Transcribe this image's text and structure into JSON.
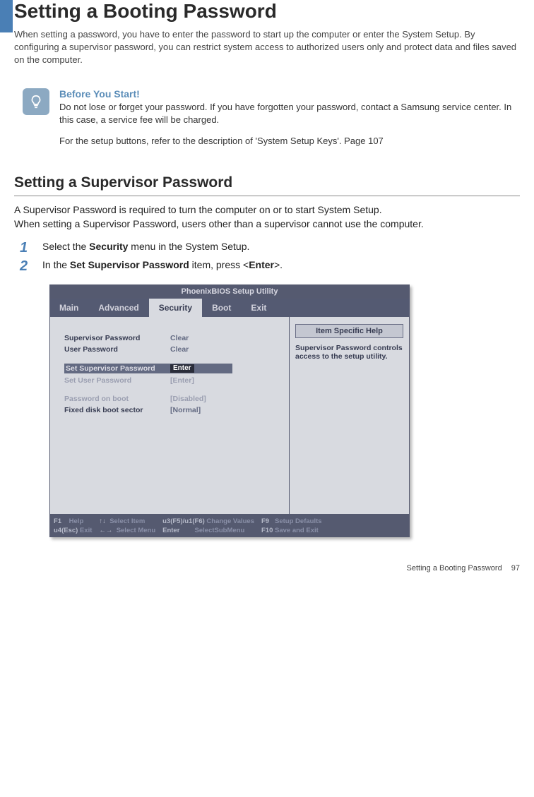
{
  "title": "Setting a Booting Password",
  "intro": "When setting a password, you have to enter the password to start up the computer or enter the System Setup. By configuring a supervisor password, you can restrict system access to authorized users only and protect data and files saved on the computer.",
  "tip": {
    "title": "Before You Start!",
    "text": "Do not lose or forget your password. If you have forgotten your password, contact a Samsung service center. In this case, a service fee will be charged.",
    "sub": "For the setup buttons, refer to the description of 'System Setup Keys'. Page 107"
  },
  "section": {
    "title": "Setting a Supervisor Password",
    "intro": "A Supervisor Password is required to turn the computer on or to start System Setup.\nWhen setting a Supervisor Password, users other than a supervisor cannot use the computer."
  },
  "steps": {
    "s1_pre": "Select the ",
    "s1_bold": "Security",
    "s1_post": " menu in the System Setup.",
    "s2_pre": "In the ",
    "s2_bold": "Set Supervisor Password",
    "s2_mid": " item, press <",
    "s2_bold2": "Enter",
    "s2_post": ">."
  },
  "bios": {
    "title": "PhoenixBIOS Setup Utility",
    "tabs": {
      "main": "Main",
      "advanced": "Advanced",
      "security": "Security",
      "boot": "Boot",
      "exit": "Exit"
    },
    "rows": {
      "sup_label": "Supervisor Password",
      "sup_val": "Clear",
      "user_label": "User Password",
      "user_val": "Clear",
      "setsup_label": "Set Supervisor Password",
      "setsup_val": "Enter",
      "setuser_label": "Set User Password",
      "setuser_val": "[Enter]",
      "pob_label": "Password on boot",
      "pob_val": "[Disabled]",
      "fdbs_label": "Fixed disk boot sector",
      "fdbs_val": "[Normal]"
    },
    "help": {
      "title": "Item Specific Help",
      "text": "Supervisor Password controls access to the setup utility."
    },
    "footer": {
      "f1": "F1",
      "help": "Help",
      "esc": "u4(Esc)",
      "exit": "Exit",
      "arrows_v": "↑↓",
      "sel_item": "Select Item",
      "arrows_h": "←→",
      "sel_menu": "Select Menu",
      "f5f6": "u3(F5)/u1(F6)",
      "change": "Change Values",
      "enter": "Enter",
      "sub": "SelectSubMenu",
      "f9": "F9",
      "defaults": "Setup Defaults",
      "f10": "F10",
      "save": "Save and Exit"
    }
  },
  "footer": {
    "label": "Setting a Booting Password",
    "page": "97"
  }
}
